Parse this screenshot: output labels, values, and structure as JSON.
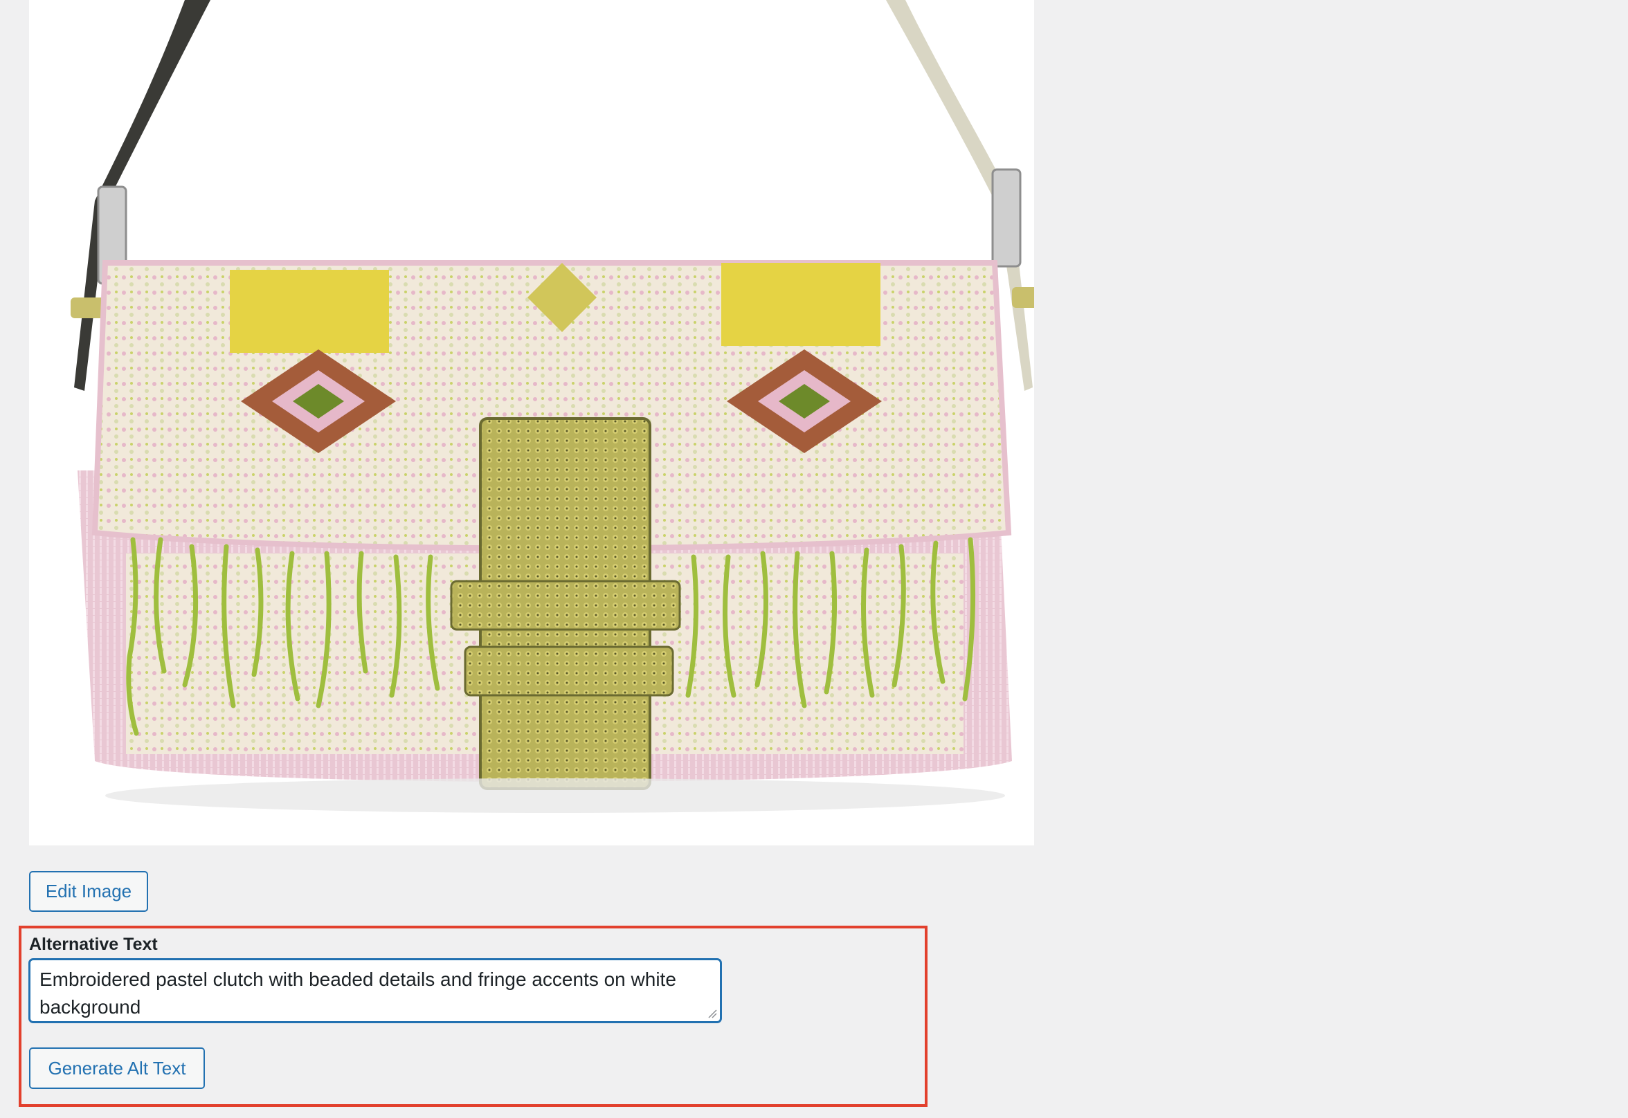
{
  "preview": {
    "image_description_icon": "beaded-handbag-image"
  },
  "buttons": {
    "edit_image_label": "Edit Image",
    "generate_alt_label": "Generate Alt Text"
  },
  "alt_text": {
    "label": "Alternative Text",
    "value": "Embroidered pastel clutch with beaded details and fringe accents on white background"
  },
  "colors": {
    "accent": "#2271b1",
    "highlight": "#e2402d",
    "background": "#f0f0f1"
  }
}
